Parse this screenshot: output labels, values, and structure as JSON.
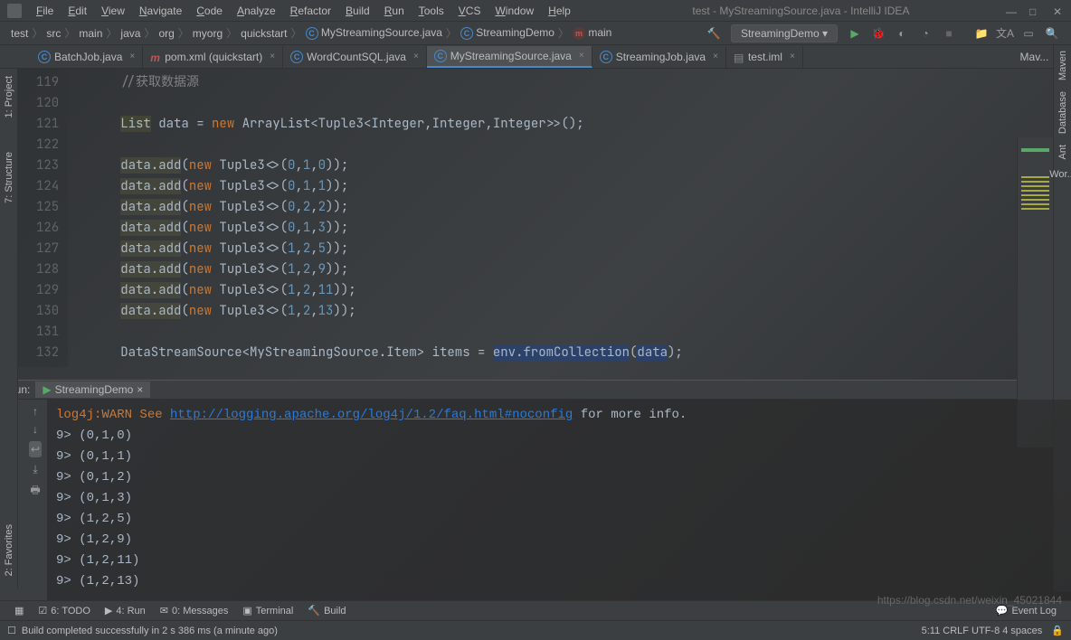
{
  "window": {
    "title": "test - MyStreamingSource.java - IntelliJ IDEA"
  },
  "menu": [
    "File",
    "Edit",
    "View",
    "Navigate",
    "Code",
    "Analyze",
    "Refactor",
    "Build",
    "Run",
    "Tools",
    "VCS",
    "Window",
    "Help"
  ],
  "breadcrumb": [
    "test",
    "src",
    "main",
    "java",
    "org",
    "myorg",
    "quickstart",
    "MyStreamingSource.java",
    "StreamingDemo",
    "main"
  ],
  "run_config": "StreamingDemo",
  "tabs": [
    {
      "label": "BatchJob.java",
      "icon": "java"
    },
    {
      "label": "pom.xml (quickstart)",
      "icon": "maven"
    },
    {
      "label": "WordCountSQL.java",
      "icon": "java"
    },
    {
      "label": "MyStreamingSource.java",
      "icon": "java",
      "active": true
    },
    {
      "label": "StreamingJob.java",
      "icon": "java"
    },
    {
      "label": "test.iml",
      "icon": "iml"
    }
  ],
  "right_labels": [
    "Mav...",
    "Maven",
    "Database",
    "Ant",
    "Wor..."
  ],
  "left_tools": [
    "1: Project",
    "7: Structure"
  ],
  "editor": {
    "line_start": 119,
    "lines": [
      {
        "n": 119,
        "segs": [
          {
            "t": "//获取数据源",
            "c": "comment"
          }
        ]
      },
      {
        "n": 120,
        "segs": []
      },
      {
        "n": 121,
        "segs": [
          {
            "t": "List",
            "c": "warn-bg"
          },
          {
            "t": " data = "
          },
          {
            "t": "new",
            "c": "kw"
          },
          {
            "t": " ArrayList<Tuple3<Integer,Integer,Integer>>();"
          }
        ]
      },
      {
        "n": 122,
        "segs": []
      },
      {
        "n": 123,
        "segs": [
          {
            "t": "data.add",
            "c": "hl"
          },
          {
            "t": "("
          },
          {
            "t": "new",
            "c": "kw"
          },
          {
            "t": " Tuple3<>("
          },
          {
            "t": "0",
            "c": "num"
          },
          {
            "t": ","
          },
          {
            "t": "1",
            "c": "num"
          },
          {
            "t": ","
          },
          {
            "t": "0",
            "c": "num"
          },
          {
            "t": "));"
          }
        ]
      },
      {
        "n": 124,
        "segs": [
          {
            "t": "data.add",
            "c": "hl"
          },
          {
            "t": "("
          },
          {
            "t": "new",
            "c": "kw"
          },
          {
            "t": " Tuple3<>("
          },
          {
            "t": "0",
            "c": "num"
          },
          {
            "t": ","
          },
          {
            "t": "1",
            "c": "num"
          },
          {
            "t": ","
          },
          {
            "t": "1",
            "c": "num"
          },
          {
            "t": "));"
          }
        ]
      },
      {
        "n": 125,
        "segs": [
          {
            "t": "data.add",
            "c": "hl"
          },
          {
            "t": "("
          },
          {
            "t": "new",
            "c": "kw"
          },
          {
            "t": " Tuple3<>("
          },
          {
            "t": "0",
            "c": "num"
          },
          {
            "t": ","
          },
          {
            "t": "2",
            "c": "num"
          },
          {
            "t": ","
          },
          {
            "t": "2",
            "c": "num"
          },
          {
            "t": "));"
          }
        ]
      },
      {
        "n": 126,
        "segs": [
          {
            "t": "data.add",
            "c": "hl"
          },
          {
            "t": "("
          },
          {
            "t": "new",
            "c": "kw"
          },
          {
            "t": " Tuple3<>("
          },
          {
            "t": "0",
            "c": "num"
          },
          {
            "t": ","
          },
          {
            "t": "1",
            "c": "num"
          },
          {
            "t": ","
          },
          {
            "t": "3",
            "c": "num"
          },
          {
            "t": "));"
          }
        ]
      },
      {
        "n": 127,
        "segs": [
          {
            "t": "data.add",
            "c": "hl"
          },
          {
            "t": "("
          },
          {
            "t": "new",
            "c": "kw"
          },
          {
            "t": " Tuple3<>("
          },
          {
            "t": "1",
            "c": "num"
          },
          {
            "t": ","
          },
          {
            "t": "2",
            "c": "num"
          },
          {
            "t": ","
          },
          {
            "t": "5",
            "c": "num"
          },
          {
            "t": "));"
          }
        ]
      },
      {
        "n": 128,
        "segs": [
          {
            "t": "data.add",
            "c": "hl"
          },
          {
            "t": "("
          },
          {
            "t": "new",
            "c": "kw"
          },
          {
            "t": " Tuple3<>("
          },
          {
            "t": "1",
            "c": "num"
          },
          {
            "t": ","
          },
          {
            "t": "2",
            "c": "num"
          },
          {
            "t": ","
          },
          {
            "t": "9",
            "c": "num"
          },
          {
            "t": "));"
          }
        ]
      },
      {
        "n": 129,
        "segs": [
          {
            "t": "data.add",
            "c": "hl"
          },
          {
            "t": "("
          },
          {
            "t": "new",
            "c": "kw"
          },
          {
            "t": " Tuple3<>("
          },
          {
            "t": "1",
            "c": "num"
          },
          {
            "t": ","
          },
          {
            "t": "2",
            "c": "num"
          },
          {
            "t": ","
          },
          {
            "t": "11",
            "c": "num"
          },
          {
            "t": "));"
          }
        ]
      },
      {
        "n": 130,
        "segs": [
          {
            "t": "data.add",
            "c": "hl"
          },
          {
            "t": "("
          },
          {
            "t": "new",
            "c": "kw"
          },
          {
            "t": " Tuple3<>("
          },
          {
            "t": "1",
            "c": "num"
          },
          {
            "t": ","
          },
          {
            "t": "2",
            "c": "num"
          },
          {
            "t": ","
          },
          {
            "t": "13",
            "c": "num"
          },
          {
            "t": "));"
          }
        ]
      },
      {
        "n": 131,
        "segs": []
      },
      {
        "n": 132,
        "segs": [
          {
            "t": "DataStreamSource<MyStreamingSource.Item> items = "
          },
          {
            "t": "env.fromCollection",
            "c": "sel"
          },
          {
            "t": "("
          },
          {
            "t": "data",
            "c": "sel"
          },
          {
            "t": ");"
          }
        ]
      }
    ]
  },
  "run_panel": {
    "label": "Run:",
    "tab": "StreamingDemo",
    "lines": [
      [
        {
          "t": "log4j:WARN See ",
          "c": "orange"
        },
        {
          "t": "http://logging.apache.org/log4j/1.2/faq.html#noconfig",
          "c": "url"
        },
        {
          "t": " for more info.",
          "c": "whitec"
        }
      ],
      [
        {
          "t": "9> ",
          "c": "whitec"
        },
        {
          "t": "(0,1,0)",
          "c": "whitec"
        }
      ],
      [
        {
          "t": "9> ",
          "c": "whitec"
        },
        {
          "t": "(0,1,1)",
          "c": "whitec"
        }
      ],
      [
        {
          "t": "9> ",
          "c": "whitec"
        },
        {
          "t": "(0,1,2)",
          "c": "whitec"
        }
      ],
      [
        {
          "t": "9> ",
          "c": "whitec"
        },
        {
          "t": "(0,1,3)",
          "c": "whitec"
        }
      ],
      [
        {
          "t": "9> ",
          "c": "whitec"
        },
        {
          "t": "(1,2,5)",
          "c": "whitec"
        }
      ],
      [
        {
          "t": "9> ",
          "c": "whitec"
        },
        {
          "t": "(1,2,9)",
          "c": "whitec"
        }
      ],
      [
        {
          "t": "9> ",
          "c": "whitec"
        },
        {
          "t": "(1,2,11)",
          "c": "whitec"
        }
      ],
      [
        {
          "t": "9> ",
          "c": "whitec"
        },
        {
          "t": "(1,2,13)",
          "c": "whitec"
        }
      ]
    ]
  },
  "bottom_tools": [
    "6: TODO",
    "4: Run",
    "0: Messages",
    "Terminal",
    "Build"
  ],
  "event_log": "Event Log",
  "status_msg": "Build completed successfully in 2 s 386 ms (a minute ago)",
  "status_right": "5:11  CRLF  UTF-8  4 spaces",
  "left_extra": "2: Favorites",
  "watermark": "https://blog.csdn.net/weixin_45021844"
}
